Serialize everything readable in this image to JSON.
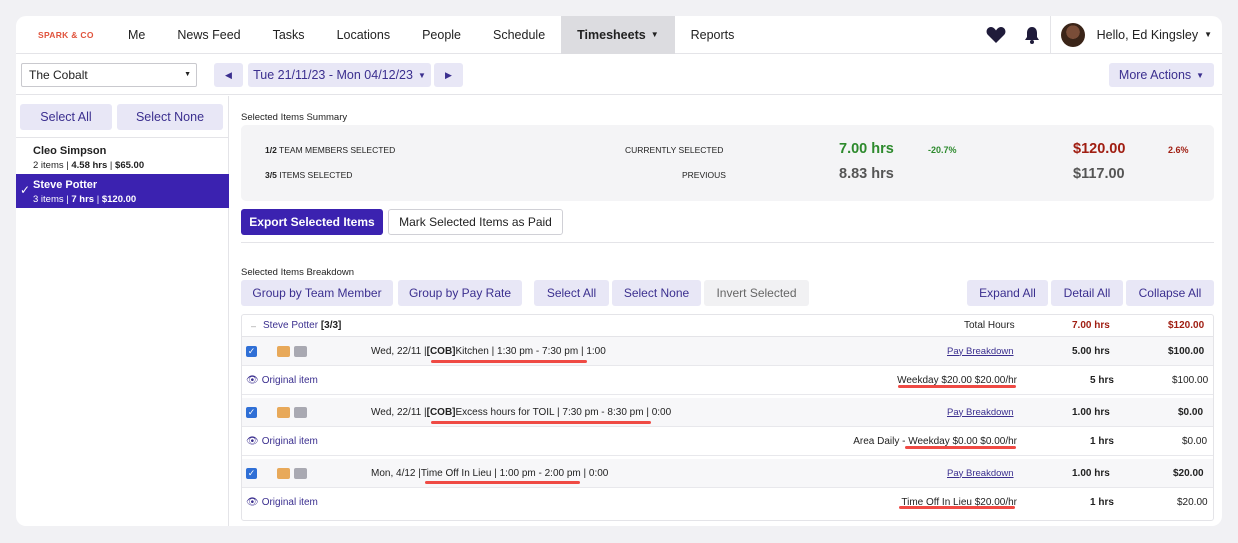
{
  "nav": {
    "logo": "SPARK & CO",
    "items": [
      "Me",
      "News Feed",
      "Tasks",
      "Locations",
      "People",
      "Schedule",
      "Timesheets",
      "Reports"
    ],
    "active_caret": "▾",
    "user_greeting": "Hello, Ed Kingsley"
  },
  "toolbar": {
    "location": "The Cobalt",
    "date_range": "Tue 21/11/23 - Mon 04/12/23",
    "more_actions": "More Actions"
  },
  "sidebar": {
    "select_all": "Select All",
    "select_none": "Select None",
    "members": [
      {
        "name": "Cleo Simpson",
        "items": "2 items",
        "hours": "4.58 hrs",
        "amount": "$65.00",
        "selected": false
      },
      {
        "name": "Steve Potter",
        "items": "3 items",
        "hours": "7 hrs",
        "amount": "$120.00",
        "selected": true
      }
    ]
  },
  "summary": {
    "title": "Selected Items Summary",
    "team_members_count": "1/2",
    "team_members_label": "TEAM MEMBERS SELECTED",
    "items_count": "3/5",
    "items_label": "ITEMS SELECTED",
    "currently_label": "CURRENTLY SELECTED",
    "previous_label": "PREVIOUS",
    "current_hours": "7.00 hrs",
    "hours_change": "-20.7%",
    "current_amount": "$120.00",
    "amount_change": "2.6%",
    "previous_hours": "8.83 hrs",
    "previous_amount": "$117.00"
  },
  "actions": {
    "export": "Export Selected Items",
    "mark_paid": "Mark Selected Items as Paid"
  },
  "breakdown": {
    "title": "Selected Items Breakdown",
    "group_member": "Group by Team Member",
    "group_rate": "Group by Pay Rate",
    "select_all": "Select All",
    "select_none": "Select None",
    "invert": "Invert Selected",
    "expand_all": "Expand All",
    "detail_all": "Detail All",
    "collapse_all": "Collapse All",
    "group_name": "Steve Potter",
    "group_count": "[3/3]",
    "total_label": "Total Hours",
    "total_hours": "7.00 hrs",
    "total_amount": "$120.00",
    "pay_breakdown": "Pay Breakdown",
    "original_item": "Original item",
    "entries": [
      {
        "date": "Wed, 22/11 | ",
        "code": "[COB]",
        "desc": " Kitchen | 1:30 pm - 7:30 pm | 1:00",
        "hours": "5.00 hrs",
        "amount": "$100.00",
        "rate": "Weekday $20.00 $20.00/hr",
        "sub_hours": "5 hrs",
        "sub_amount": "$100.00"
      },
      {
        "date": "Wed, 22/11 | ",
        "code": "[COB]",
        "desc": " Excess hours for TOIL | 7:30 pm - 8:30 pm | 0:00",
        "hours": "1.00 hrs",
        "amount": "$0.00",
        "rate": "Area Daily - Weekday $0.00 $0.00/hr",
        "sub_hours": "1 hrs",
        "sub_amount": "$0.00"
      },
      {
        "date": "Mon, 4/12 | ",
        "code": "",
        "desc": "Time Off In Lieu | 1:00 pm - 2:00 pm | 0:00",
        "hours": "1.00 hrs",
        "amount": "$20.00",
        "rate": "Time Off In Lieu $20.00/hr",
        "sub_hours": "1 hrs",
        "sub_amount": "$20.00"
      }
    ]
  },
  "colors": {
    "accent": "#3b22b0",
    "highlight": "#ef4a44",
    "positive": "#2d8a2d",
    "money": "#a01e12"
  }
}
